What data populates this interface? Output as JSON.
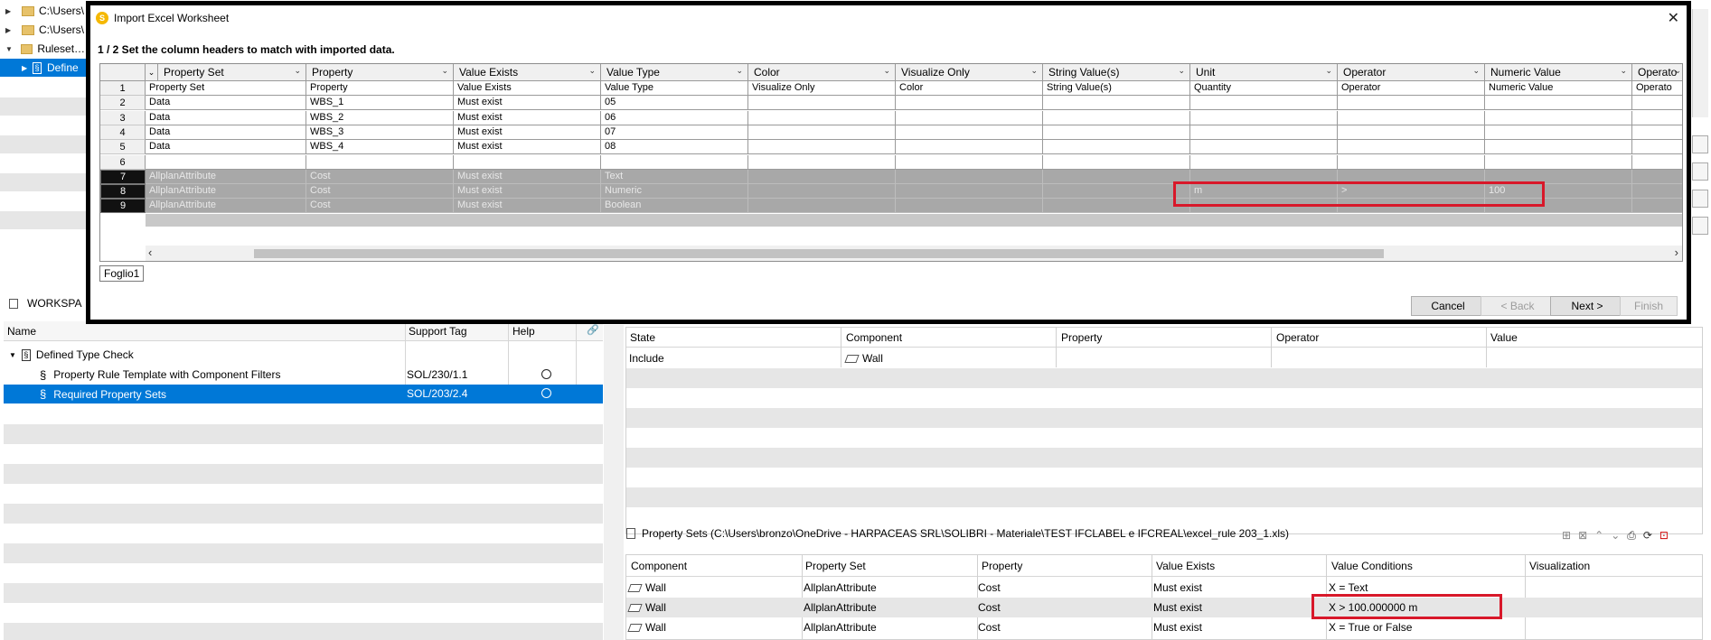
{
  "tree": {
    "items": [
      {
        "label": "C:\\Users\\"
      },
      {
        "label": "C:\\Users\\"
      },
      {
        "label": "Rulesets C"
      },
      {
        "label": "Define"
      }
    ]
  },
  "workspace": {
    "title": "WORKSPA",
    "columns": [
      "Name",
      "Support Tag",
      "Help"
    ],
    "rows": [
      {
        "name": "Defined Type Check",
        "tag": ""
      },
      {
        "name": "Property Rule Template with Component Filters",
        "tag": "SOL/230/1.1"
      },
      {
        "name": "Required Property Sets",
        "tag": "SOL/203/2.4"
      }
    ]
  },
  "filters": {
    "columns": [
      "State",
      "Component",
      "Property",
      "Operator",
      "Value"
    ],
    "rows": [
      {
        "state": "Include",
        "component": "Wall"
      }
    ]
  },
  "property_sets": {
    "header": "Property Sets (C:\\Users\\bronzo\\OneDrive - HARPACEAS SRL\\SOLIBRI - Materiale\\TEST IFCLABEL e IFCREAL\\excel_rule 203_1.xls)",
    "columns": [
      "Component",
      "Property Set",
      "Property",
      "Value Exists",
      "Value Conditions",
      "Visualization"
    ],
    "rows": [
      {
        "component": "Wall",
        "set": "AllplanAttribute",
        "property": "Cost",
        "exists": "Must exist",
        "condition": "X = Text"
      },
      {
        "component": "Wall",
        "set": "AllplanAttribute",
        "property": "Cost",
        "exists": "Must exist",
        "condition": "X > 100.000000 m"
      },
      {
        "component": "Wall",
        "set": "AllplanAttribute",
        "property": "Cost",
        "exists": "Must exist",
        "condition": "X = True or False"
      }
    ]
  },
  "dialog": {
    "title": "Import Excel Worksheet",
    "icon_letter": "S",
    "instruction": "1 / 2 Set the column headers to match with imported data.",
    "sheet_tab": "Foglio1",
    "buttons": {
      "cancel": "Cancel",
      "back": "< Back",
      "next": "Next >",
      "finish": "Finish"
    },
    "column_headers": [
      "Property Set",
      "Property",
      "Value Exists",
      "Value Type",
      "Color",
      "Visualize Only",
      "String Value(s)",
      "Unit",
      "Operator",
      "Numeric Value",
      "Operato"
    ],
    "rows": [
      {
        "num": "1",
        "cells": [
          "Property Set",
          "Property",
          "Value Exists",
          "Value Type",
          "Visualize Only",
          "Color",
          "String Value(s)",
          "Quantity",
          "Operator",
          "Numeric Value",
          "Operato"
        ]
      },
      {
        "num": "2",
        "cells": [
          "Data",
          "WBS_1",
          "Must exist",
          "05",
          "",
          "",
          "",
          "",
          "",
          "",
          ""
        ]
      },
      {
        "num": "3",
        "cells": [
          "Data",
          "WBS_2",
          "Must exist",
          "06",
          "",
          "",
          "",
          "",
          "",
          "",
          ""
        ]
      },
      {
        "num": "4",
        "cells": [
          "Data",
          "WBS_3",
          "Must exist",
          "07",
          "",
          "",
          "",
          "",
          "",
          "",
          ""
        ]
      },
      {
        "num": "5",
        "cells": [
          "Data",
          "WBS_4",
          "Must exist",
          "08",
          "",
          "",
          "",
          "",
          "",
          "",
          ""
        ]
      },
      {
        "num": "6",
        "cells": [
          "",
          "",
          "",
          "",
          "",
          "",
          "",
          "",
          "",
          "",
          ""
        ]
      },
      {
        "num": "7",
        "cells": [
          "AllplanAttribute",
          "Cost",
          "Must exist",
          "Text",
          "",
          "",
          "",
          "",
          "",
          "",
          ""
        ]
      },
      {
        "num": "8",
        "cells": [
          "AllplanAttribute",
          "Cost",
          "Must exist",
          "Numeric",
          "",
          "",
          "",
          "m",
          ">",
          "100",
          ""
        ]
      },
      {
        "num": "9",
        "cells": [
          "AllplanAttribute",
          "Cost",
          "Must exist",
          "Boolean",
          "",
          "",
          "",
          "",
          "",
          "",
          ""
        ]
      }
    ]
  },
  "colors": {
    "highlight": "#d8182a",
    "selection": "#0078d7"
  }
}
